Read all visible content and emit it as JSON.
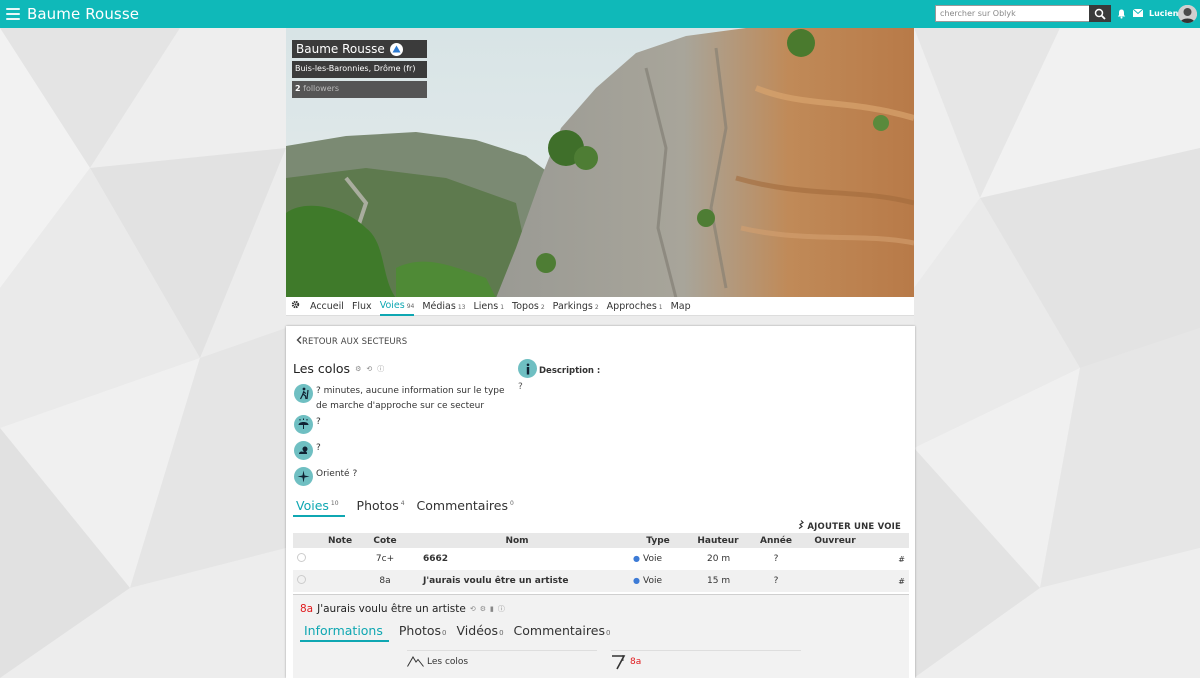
{
  "header": {
    "site_title": "Baume Rousse",
    "search_placeholder": "chercher sur Oblyk",
    "user_name": "Lucien"
  },
  "crag": {
    "name": "Baume Rousse",
    "location": "Buis-les-Baronnies, Drôme (fr)",
    "followers_count": "2",
    "followers_label": "followers"
  },
  "crag_tabs": [
    {
      "label": "Accueil",
      "count": ""
    },
    {
      "label": "Flux",
      "count": ""
    },
    {
      "label": "Voies",
      "count": "94",
      "active": true
    },
    {
      "label": "Médias",
      "count": "13"
    },
    {
      "label": "Liens",
      "count": "1"
    },
    {
      "label": "Topos",
      "count": "2"
    },
    {
      "label": "Parkings",
      "count": "2"
    },
    {
      "label": "Approches",
      "count": "1"
    },
    {
      "label": "Map",
      "count": ""
    }
  ],
  "sector": {
    "back_label": "RETOUR AUX SECTEURS",
    "title": "Les colos",
    "approach_text": "? minutes, aucune information sur le type de marche d'approche sur ce secteur",
    "rain_text": "?",
    "sun_text": "?",
    "orientation_text": "Orienté ?",
    "description_label": "Description :",
    "description_text": "?"
  },
  "sub_tabs": [
    {
      "label": "Voies",
      "count": "10",
      "active": true
    },
    {
      "label": "Photos",
      "count": "4"
    },
    {
      "label": "Commentaires",
      "count": "0"
    }
  ],
  "add_route_label": "AJOUTER UNE VOIE",
  "table": {
    "columns": [
      "Note",
      "Cote",
      "Nom",
      "Type",
      "Hauteur",
      "Année",
      "Ouvreur"
    ],
    "rows": [
      {
        "note": "",
        "grade": "7c+",
        "grade_color": "#8b2a8a",
        "name": "6662",
        "type": "Voie",
        "height": "20 m",
        "year": "?",
        "opener": "",
        "hash": "#"
      },
      {
        "note": "",
        "grade": "8a",
        "grade_color": "#e0191c",
        "name": "J'aurais voulu être un artiste",
        "type": "Voie",
        "height": "15 m",
        "year": "?",
        "opener": "",
        "hash": "#"
      }
    ]
  },
  "route_detail": {
    "grade": "8a",
    "name": "J'aurais voulu être un artiste",
    "tabs": [
      {
        "label": "Informations",
        "count": "",
        "active": true
      },
      {
        "label": "Photos",
        "count": "0"
      },
      {
        "label": "Vidéos",
        "count": "0"
      },
      {
        "label": "Commentaires",
        "count": "0"
      }
    ],
    "sector_label": "Les colos",
    "grade_label": "8a"
  },
  "colors": {
    "accent": "#0fb9b9",
    "tab_active": "#0fa7b2",
    "grade_7c_plus": "#8b2a8a",
    "grade_8a": "#e0191c"
  }
}
